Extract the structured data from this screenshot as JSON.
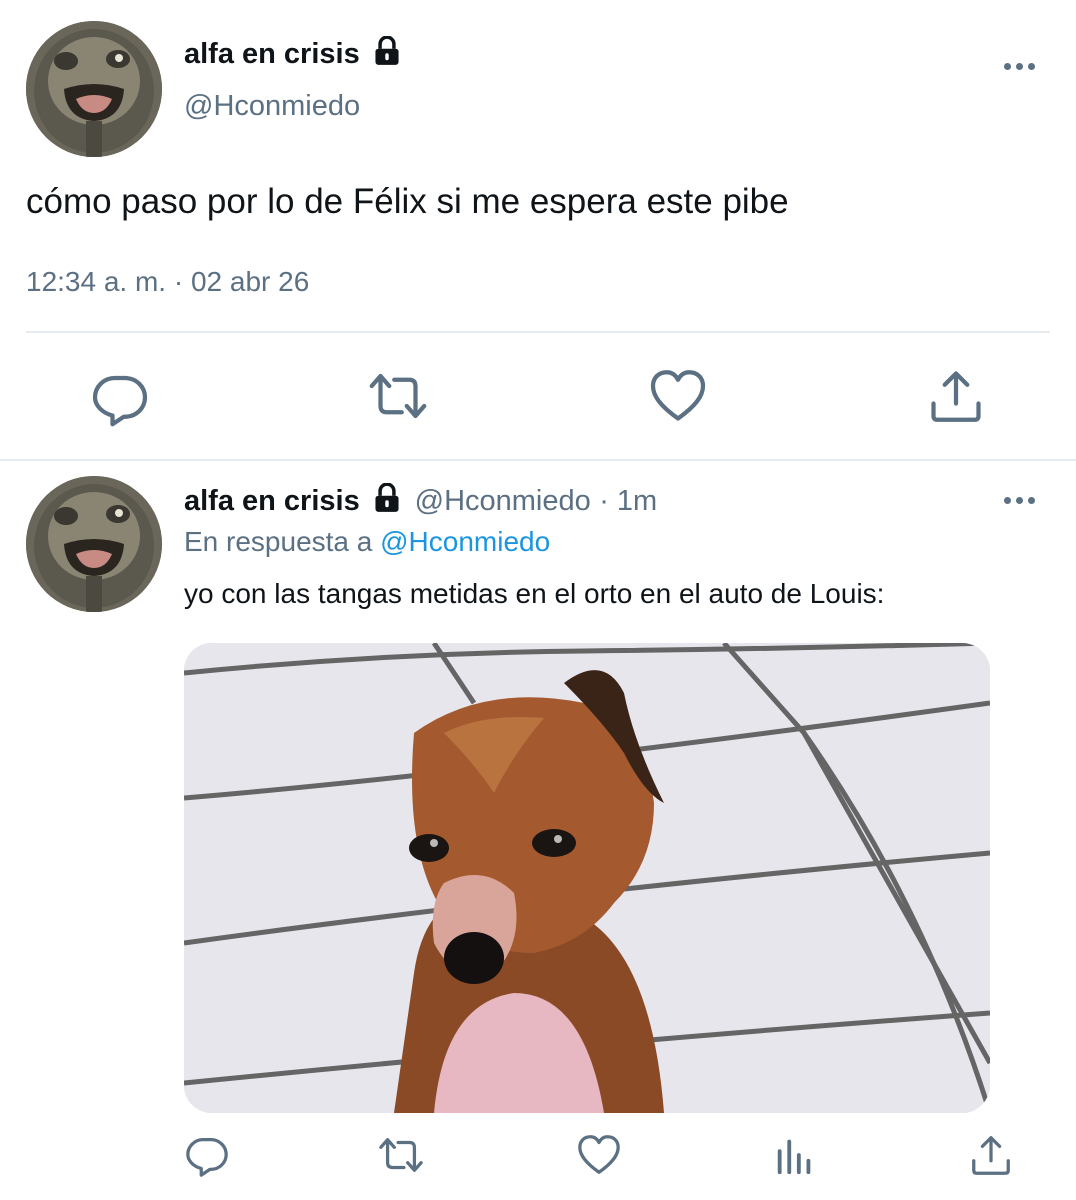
{
  "tweets": [
    {
      "author": {
        "name": "alfa en crisis",
        "handle": "@Hconmiedo",
        "avatar": "creepy-figure-avatar",
        "protected_icon": "lock-icon"
      },
      "text": "cómo paso por lo de Félix si me espera este pibe",
      "timestamp": "12:34 a. m. · 02 abr 26",
      "actions": [
        "reply-icon",
        "retweet-icon",
        "like-icon",
        "share-icon"
      ]
    },
    {
      "author": {
        "name": "alfa en crisis",
        "handle": "@Hconmiedo",
        "avatar": "creepy-figure-avatar",
        "protected_icon": "lock-icon"
      },
      "time": "· 1m",
      "reply_prefix": "En respuesta a",
      "reply_to": "@Hconmiedo",
      "text": "yo con las tangas metidas en el orto en el auto de Louis:",
      "media": "dog-photo",
      "actions": [
        "reply-icon",
        "retweet-icon",
        "like-icon",
        "analytics-icon",
        "share-icon"
      ]
    }
  ],
  "colors": {
    "text_primary": "#0f1419",
    "text_secondary": "#5b7083",
    "link": "#1b95e0",
    "divider": "#e6ecf0"
  }
}
